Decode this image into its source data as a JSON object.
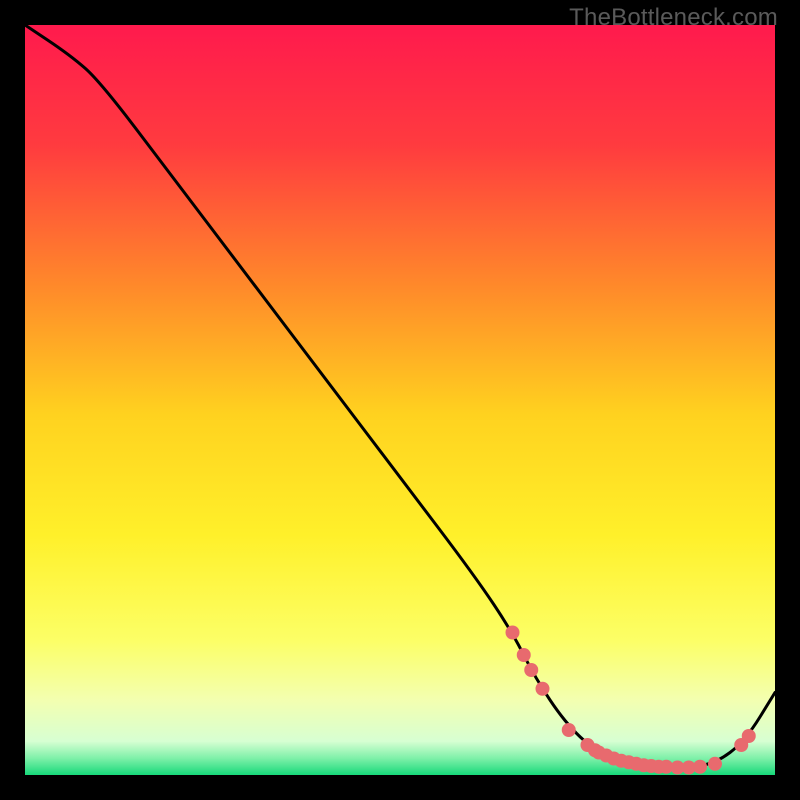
{
  "watermark": "TheBottleneck.com",
  "chart_data": {
    "type": "line",
    "title": "",
    "xlabel": "",
    "ylabel": "",
    "xlim": [
      0,
      100
    ],
    "ylim": [
      0,
      100
    ],
    "gradient_stops": [
      {
        "offset": 0,
        "color": "#ff1a4d"
      },
      {
        "offset": 0.16,
        "color": "#ff3b3f"
      },
      {
        "offset": 0.35,
        "color": "#ff8a2a"
      },
      {
        "offset": 0.52,
        "color": "#ffd21f"
      },
      {
        "offset": 0.68,
        "color": "#fff02a"
      },
      {
        "offset": 0.82,
        "color": "#fcff66"
      },
      {
        "offset": 0.9,
        "color": "#f3ffb0"
      },
      {
        "offset": 0.955,
        "color": "#d7ffd2"
      },
      {
        "offset": 0.978,
        "color": "#7df0a8"
      },
      {
        "offset": 1.0,
        "color": "#17d97a"
      }
    ],
    "series": [
      {
        "name": "bottleneck-curve",
        "x": [
          0,
          6,
          10,
          20,
          30,
          40,
          50,
          60,
          65,
          68,
          72,
          76,
          80,
          84,
          88,
          92,
          96,
          100
        ],
        "y": [
          100,
          96,
          92.5,
          79.3,
          66.1,
          52.9,
          39.7,
          26.5,
          19,
          13,
          7,
          3.2,
          1.6,
          1.0,
          1.0,
          1.5,
          4.5,
          11
        ]
      }
    ],
    "scatter": [
      {
        "x": 65.0,
        "y": 19.0
      },
      {
        "x": 66.5,
        "y": 16.0
      },
      {
        "x": 67.5,
        "y": 14.0
      },
      {
        "x": 69.0,
        "y": 11.5
      },
      {
        "x": 72.5,
        "y": 6.0
      },
      {
        "x": 75.0,
        "y": 4.0
      },
      {
        "x": 76.0,
        "y": 3.3
      },
      {
        "x": 76.5,
        "y": 3.0
      },
      {
        "x": 77.5,
        "y": 2.6
      },
      {
        "x": 78.5,
        "y": 2.2
      },
      {
        "x": 79.5,
        "y": 1.9
      },
      {
        "x": 80.5,
        "y": 1.7
      },
      {
        "x": 81.5,
        "y": 1.5
      },
      {
        "x": 82.5,
        "y": 1.3
      },
      {
        "x": 83.5,
        "y": 1.2
      },
      {
        "x": 84.5,
        "y": 1.1
      },
      {
        "x": 85.5,
        "y": 1.1
      },
      {
        "x": 87.0,
        "y": 1.0
      },
      {
        "x": 88.5,
        "y": 1.0
      },
      {
        "x": 90.0,
        "y": 1.1
      },
      {
        "x": 92.0,
        "y": 1.5
      },
      {
        "x": 95.5,
        "y": 4.0
      },
      {
        "x": 96.5,
        "y": 5.2
      }
    ],
    "point_style": {
      "radius_px": 7,
      "fill": "#e86a6e",
      "stroke": "#c24047",
      "stroke_width": 0
    },
    "curve_style": {
      "stroke": "#000000",
      "stroke_width": 3
    }
  }
}
